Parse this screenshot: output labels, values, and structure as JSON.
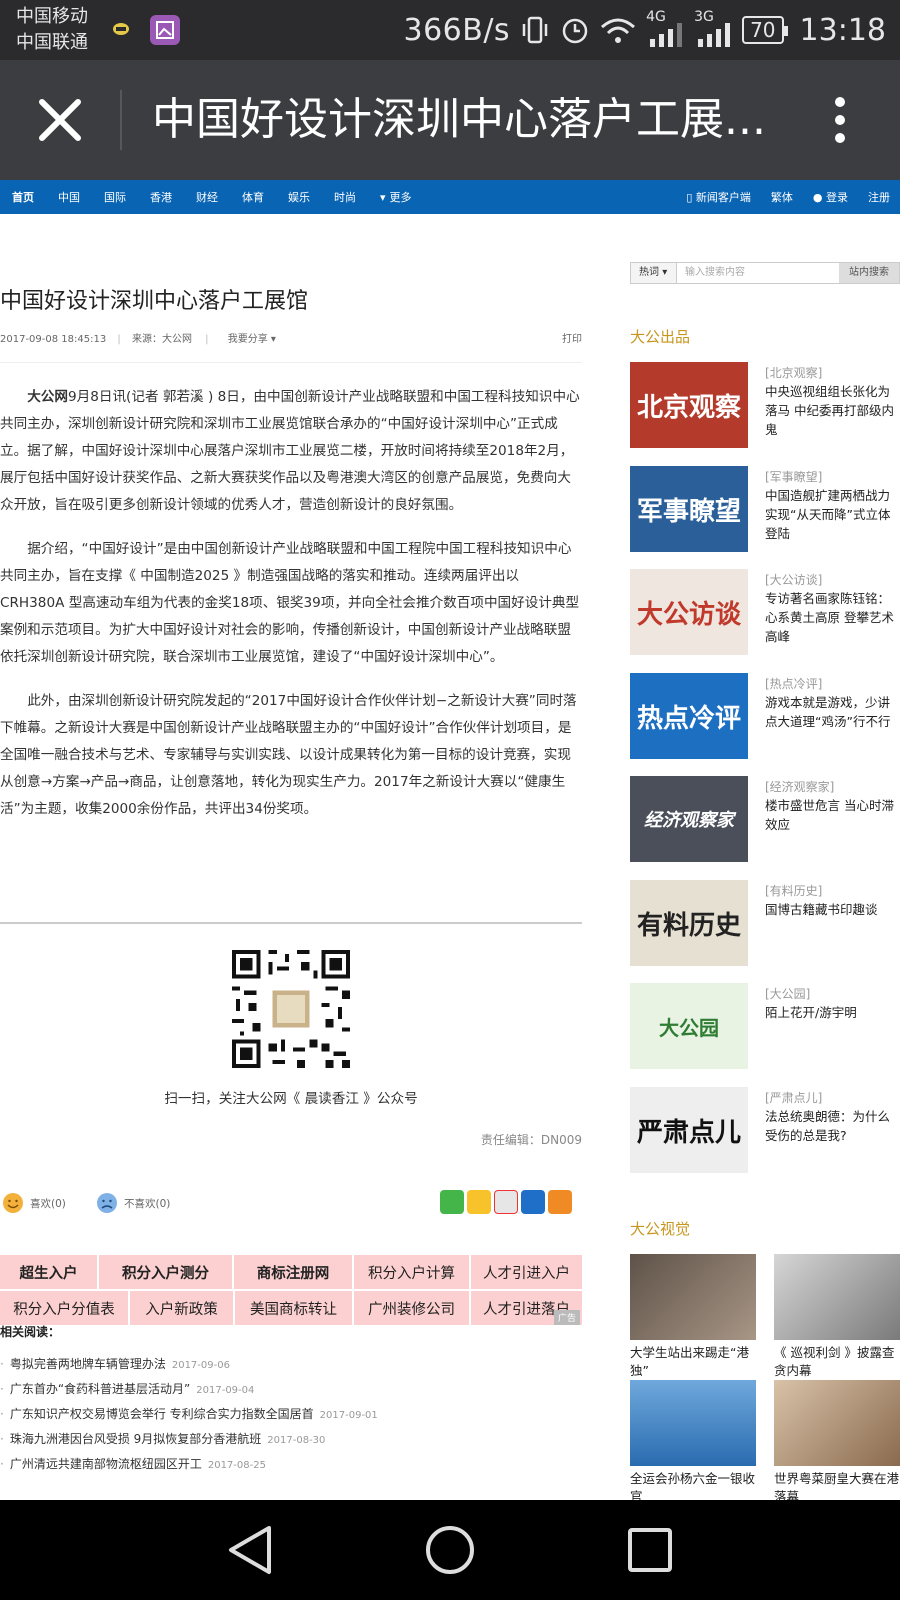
{
  "status_bar": {
    "carrier1": "中国移动",
    "carrier2": "中国联通",
    "speed": "366B/s",
    "net1": "4G",
    "net2": "3G",
    "battery": "70",
    "time": "13:18"
  },
  "title_bar": {
    "title": "中国好设计深圳中心落户工展..."
  },
  "nav": {
    "items": [
      "首页",
      "中国",
      "国际",
      "香港",
      "财经",
      "体育",
      "娱乐",
      "时尚",
      "更多"
    ],
    "right": {
      "app": "新闻客户端",
      "trad": "繁体",
      "login": "登录",
      "register": "注册"
    }
  },
  "article": {
    "title": "中国好设计深圳中心落户工展馆",
    "datetime": "2017-09-08 18:45:13",
    "source": "来源：大公网",
    "share": "我要分享",
    "print": "打印",
    "lead_bold": "大公网",
    "p1": "9月8日讯(记者 郭若溪 ) 8日，由中国创新设计产业战略联盟和中国工程科技知识中心共同主办，深圳创新设计研究院和深圳市工业展览馆联合承办的“中国好设计深圳中心”正式成立。据了解，中国好设计深圳中心展落户深圳市工业展览二楼，开放时间将持续至2018年2月，展厅包括中国好设计获奖作品、之新大赛获奖作品以及粤港澳大湾区的创意产品展览，免费向大众开放，旨在吸引更多创新设计领域的优秀人才，营造创新设计的良好氛围。",
    "p2": "据介绍，“中国好设计”是由中国创新设计产业战略联盟和中国工程院中国工程科技知识中心共同主办，旨在支撑《 中国制造2025 》制造强国战略的落实和推动。连续两届评出以CRH380A 型高速动车组为代表的金奖18项、银奖39项，并向全社会推介数百项中国好设计典型案例和示范项目。为扩大中国好设计对社会的影响，传播创新设计，中国创新设计产业战略联盟依托深圳创新设计研究院，联合深圳市工业展览馆，建设了“中国好设计深圳中心”。",
    "p3": "此外，由深圳创新设计研究院发起的“2017中国好设计合作伙伴计划−之新设计大赛”同时落下帷幕。之新设计大赛是中国创新设计产业战略联盟主办的“中国好设计”合作伙伴计划项目，是全国唯一融合技术与艺术、专家辅导与实训实践、以设计成果转化为第一目标的设计竞赛，实现从创意→方案→产品→商品，让创意落地，转化为现实生产力。2017年之新设计大赛以“健康生活”为主题，收集2000余份作品，共评出34份奖项。",
    "qr_caption": "扫一扫，关注大公网《 晨读香江 》公众号",
    "editor": "责任编辑：DN009",
    "like": "喜欢(0)",
    "dislike": "不喜欢(0)"
  },
  "ads": {
    "row1": [
      "超生入户",
      "积分入户测分",
      "商标注册网",
      "积分入户计算",
      "人才引进入户"
    ],
    "row2": [
      "积分入户分值表",
      "入户新政策",
      "美国商标转让",
      "广州装修公司",
      "人才引进落户"
    ],
    "badge": "广告"
  },
  "related": {
    "heading": "相关阅读：",
    "items": [
      {
        "t": "粤拟完善两地牌车辆管理办法",
        "d": "2017-09-06"
      },
      {
        "t": "广东首办“食药科普进基层活动月”",
        "d": "2017-09-04"
      },
      {
        "t": "广东知识产权交易博览会举行 专利综合实力指数全国居首",
        "d": "2017-09-01"
      },
      {
        "t": "珠海九洲港因台风受损 9月拟恢复部分香港航班",
        "d": "2017-08-30"
      },
      {
        "t": "广州清远共建南部物流枢纽园区开工",
        "d": "2017-08-25"
      }
    ]
  },
  "sidebar": {
    "search": {
      "hot": "热词",
      "placeholder": "输入搜索内容",
      "button": "站内搜索"
    },
    "picks_heading": "大公出品",
    "picks": [
      {
        "thumb": "北京观察",
        "tag": "[北京观察]",
        "text": "中央巡视组组长张化为落马 中纪委再打部级内鬼",
        "color": "#b43a2c"
      },
      {
        "thumb": "军事瞭望",
        "tag": "[军事瞭望]",
        "text": "中国造舰扩建两栖战力 实现“从天而降”式立体登陆",
        "color": "#2a5f9a"
      },
      {
        "thumb": "大公访谈",
        "tag": "[大公访谈]",
        "text": "专访著名画家陈钰铭：心系黄土高原 登攀艺术高峰",
        "color": "#e8d8d0"
      },
      {
        "thumb": "热点冷评",
        "tag": "[热点冷评]",
        "text": "游戏本就是游戏，少讲点大道理“鸡汤”行不行",
        "color": "#1d6fc2"
      },
      {
        "thumb": "经济观察家",
        "tag": "[经济观察家]",
        "text": "楼市盛世危言 当心时滞效应",
        "color": "#4a4f5a"
      },
      {
        "thumb": "有料历史",
        "tag": "[有料历史]",
        "text": "国博古籍藏书印趣谈",
        "color": "#d9d2c2"
      },
      {
        "thumb": "大公园",
        "tag": "[大公园]",
        "text": "陌上花开/游宇明",
        "color": "#6aa84f"
      },
      {
        "thumb": "严肃点儿",
        "tag": "[严肃点儿]",
        "text": "法总统奥朗德：为什么受伤的总是我?",
        "color": "#e0e0e0"
      }
    ],
    "visual_heading": "大公视觉",
    "visual": [
      {
        "cap": "大学生站出来踢走“港独”",
        "color": "#8a7a6a"
      },
      {
        "cap": "《 巡视利剑 》披露查贪内幕",
        "color": "#9a9a9a"
      },
      {
        "cap": "全运会孙杨六金一银收官",
        "color": "#3a78b8"
      },
      {
        "cap": "世界粤菜厨皇大赛在港落幕",
        "color": "#b89878"
      }
    ]
  }
}
